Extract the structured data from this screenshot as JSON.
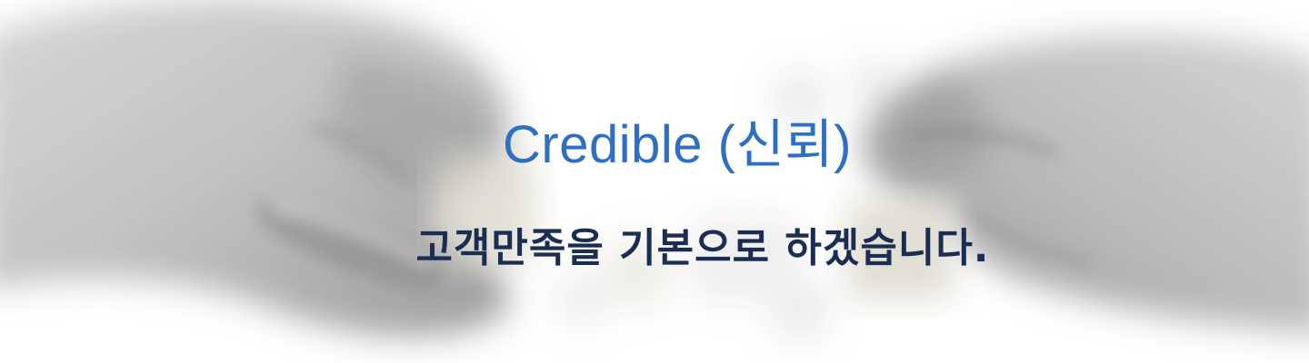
{
  "banner": {
    "headline": "Credible (신뢰)",
    "subline": "고객만족을 기본으로 하겠습니다.",
    "headline_color": "#2f6fc3",
    "subline_color": "#1b2d52",
    "background_image": "hands-connecting-puzzle-pieces-blurred-photo"
  }
}
